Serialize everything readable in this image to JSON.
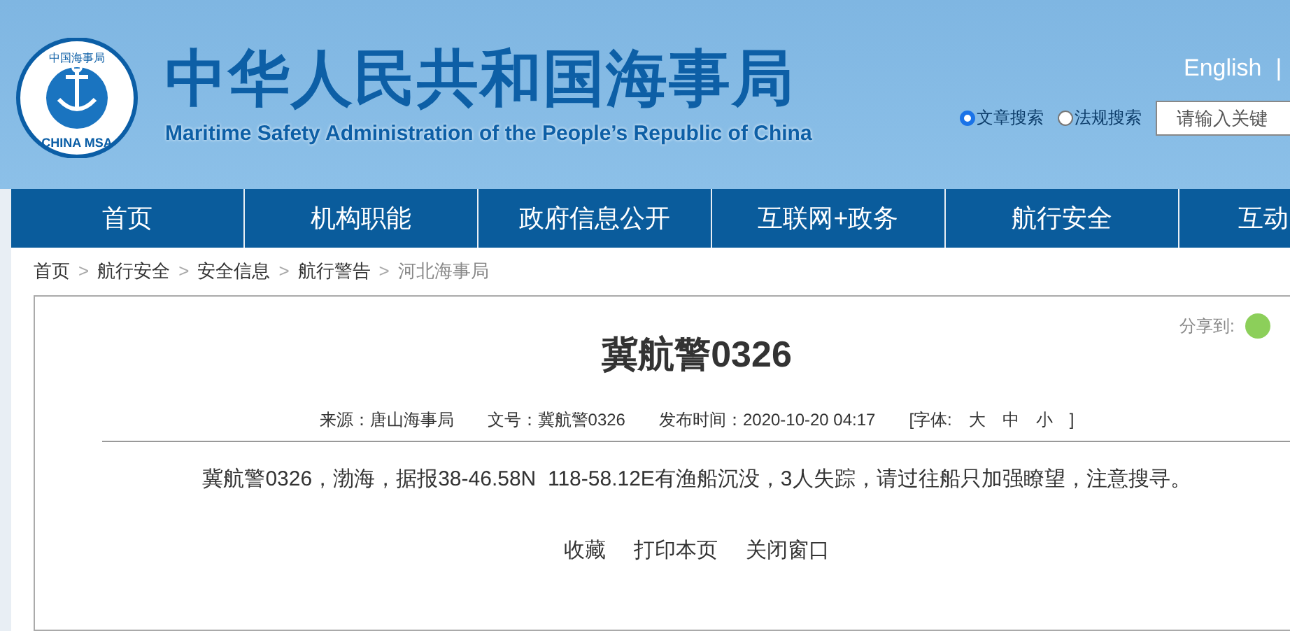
{
  "header": {
    "logo": {
      "top_text": "中国海事局",
      "bottom_text": "CHINA MSA"
    },
    "title": "中华人民共和国海事局",
    "subtitle": "Maritime Safety Administration of the People’s Republic of China",
    "language_link": "English",
    "separator": "|",
    "search_modes": [
      {
        "label": "文章搜索",
        "selected": true
      },
      {
        "label": "法规搜索",
        "selected": false
      }
    ],
    "search": {
      "placeholder": "请输入关键"
    }
  },
  "nav": [
    {
      "label": "首页"
    },
    {
      "label": "机构职能"
    },
    {
      "label": "政府信息公开"
    },
    {
      "label": "互联网+政务"
    },
    {
      "label": "航行安全"
    },
    {
      "label": "互动"
    }
  ],
  "breadcrumb": [
    {
      "label": "首页",
      "current": false
    },
    {
      "label": "航行安全",
      "current": false
    },
    {
      "label": "安全信息",
      "current": false
    },
    {
      "label": "航行警告",
      "current": false
    },
    {
      "label": "河北海事局",
      "current": true
    }
  ],
  "breadcrumb_separator": ">",
  "article": {
    "share_label": "分享到:",
    "title": "冀航警0326",
    "meta": [
      {
        "text": "来源：唐山海事局"
      },
      {
        "text": "文号：冀航警0326"
      },
      {
        "text": "发布时间：2020-10-20 04:17"
      }
    ],
    "font_size": {
      "label": "[字体:",
      "options": [
        "大",
        "中",
        "小"
      ],
      "close": "]"
    },
    "body": "冀航警0326，渤海，据报38-46.58N  118-58.12E有渔船沉没，3人失踪，请过往船只加强瞭望，注意搜寻。",
    "actions": [
      "收藏",
      "打印本页",
      "关闭窗口"
    ]
  }
}
